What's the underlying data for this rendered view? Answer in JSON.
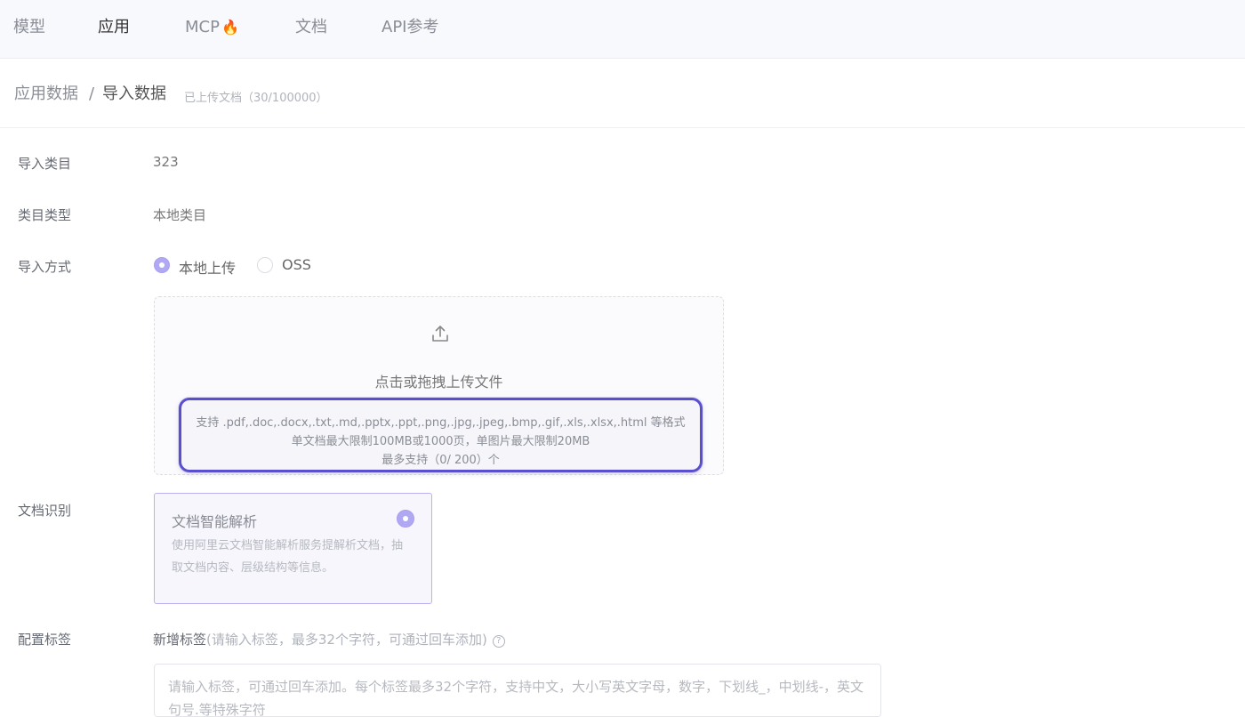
{
  "nav": {
    "items": [
      {
        "label": "模型"
      },
      {
        "label": "应用"
      },
      {
        "label": "MCP"
      },
      {
        "label": "文档"
      },
      {
        "label": "API参考"
      }
    ],
    "fire_icon": "🔥"
  },
  "breadcrumb": {
    "parent": "应用数据",
    "separator": "/",
    "current": "导入数据",
    "count_text": "已上传文档（30/100000）"
  },
  "form": {
    "category_label": "导入类目",
    "category_value": "323",
    "type_label": "类目类型",
    "type_value": "本地类目",
    "method_label": "导入方式",
    "method_options": [
      {
        "label": "本地上传",
        "selected": true
      },
      {
        "label": "OSS",
        "selected": false
      }
    ],
    "recognition_label": "文档识别",
    "tags_label": "配置标签"
  },
  "upload": {
    "title": "点击或拖拽上传文件",
    "hint_formats": "支持 .pdf,.doc,.docx,.txt,.md,.pptx,.ppt,.png,.jpg,.jpeg,.bmp,.gif,.xls,.xlsx,.html 等格式",
    "hint_size": "单文档最大限制100MB或1000页，单图片最大限制20MB",
    "hint_max": "最多支持（0/ 200）个"
  },
  "parse_card": {
    "title": "文档智能解析",
    "description": "使用阿里云文档智能解析服务提解析文档，抽取文档内容、层级结构等信息。",
    "selected": true
  },
  "tags": {
    "add_label": "新增标签",
    "add_hint": "(请输入标签，最多32个字符，可通过回车添加)",
    "placeholder": "请输入标签，可通过回车添加。每个标签最多32个字符，支持中文，大小写英文字母，数字，下划线_，中划线-，英文句号.等特殊字符"
  },
  "colors": {
    "accent": "#5a4fcf",
    "radio_selected": "#b0a8f2"
  }
}
